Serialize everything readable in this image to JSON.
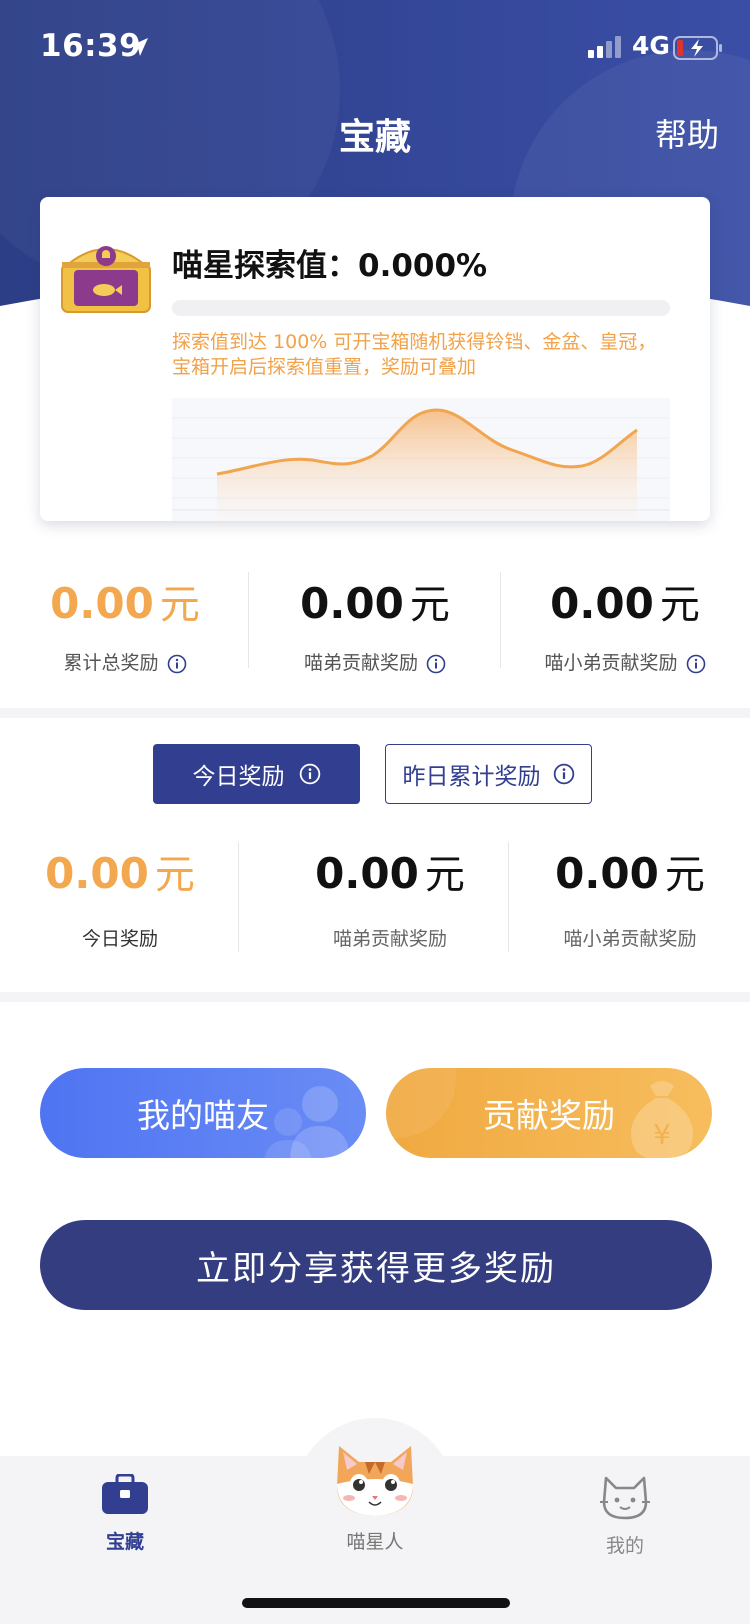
{
  "status_bar": {
    "time": "16:39",
    "network": "4G"
  },
  "header": {
    "title": "宝藏",
    "help": "帮助"
  },
  "explore_card": {
    "label": "喵星探索值：0.000%",
    "progress": 0.0,
    "description": "探索值到达 100% 可开宝箱随机获得铃铛、金盆、皇冠，宝箱开启后探索值重置，奖励可叠加"
  },
  "totals": [
    {
      "value": "0.00",
      "unit": "元",
      "label": "累计总奖励"
    },
    {
      "value": "0.00",
      "unit": "元",
      "label": "喵弟贡献奖励"
    },
    {
      "value": "0.00",
      "unit": "元",
      "label": "喵小弟贡献奖励"
    }
  ],
  "tabs": {
    "today": "今日奖励",
    "yesterday": "昨日累计奖励"
  },
  "today": [
    {
      "value": "0.00",
      "unit": "元",
      "label": "今日奖励"
    },
    {
      "value": "0.00",
      "unit": "元",
      "label": "喵弟贡献奖励"
    },
    {
      "value": "0.00",
      "unit": "元",
      "label": "喵小弟贡献奖励"
    }
  ],
  "buttons": {
    "friends": "我的喵友",
    "contribute": "贡献奖励",
    "share": "立即分享获得更多奖励"
  },
  "tabbar": {
    "treasure": "宝藏",
    "cat": "喵星人",
    "mine": "我的"
  },
  "colors": {
    "primary": "#323f91",
    "accent": "#f3a84f",
    "blue": "#5b7ff4"
  },
  "icons": [
    "location-arrow-icon",
    "signal-icon",
    "battery-icon",
    "treasure-chest-icon",
    "info-icon",
    "people-icon",
    "money-bag-icon",
    "briefcase-icon",
    "cat-face-icon",
    "cat-outline-icon"
  ]
}
